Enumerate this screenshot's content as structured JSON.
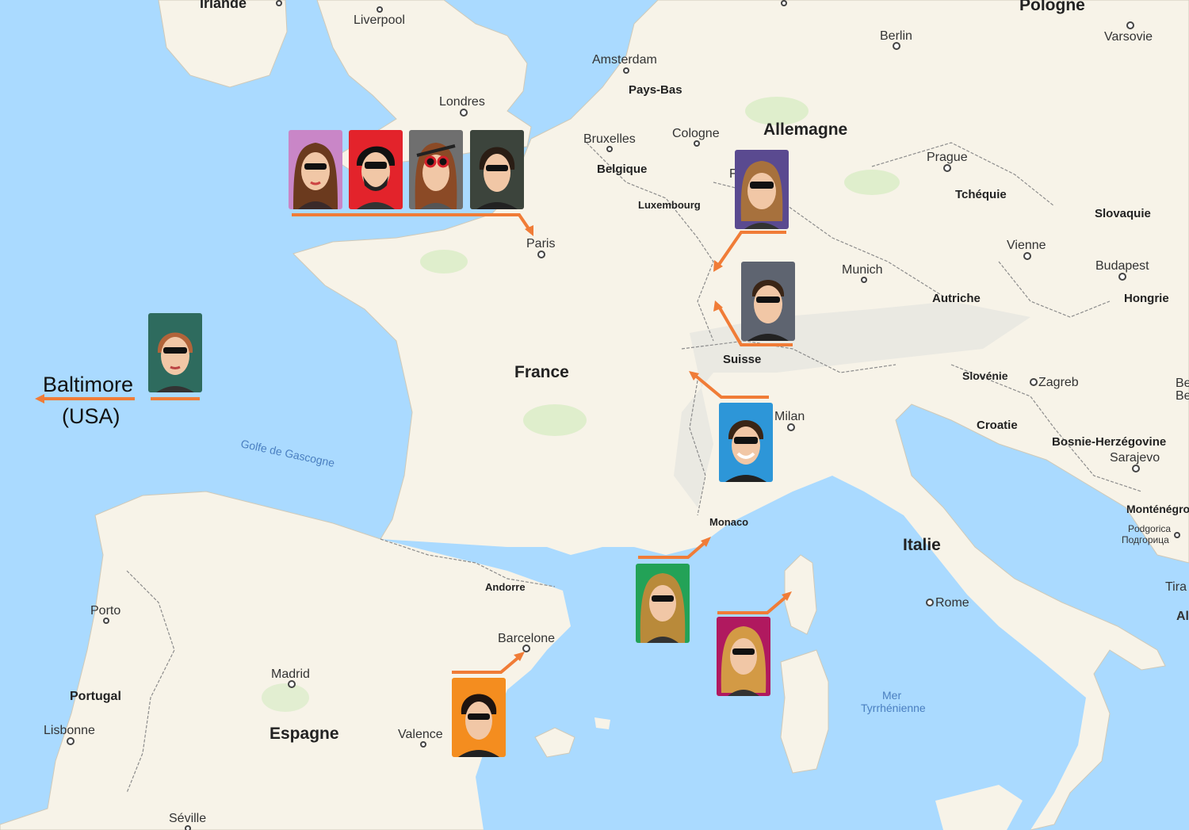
{
  "map": {
    "water": {
      "golfe": "Golfe de Gascogne",
      "mer1": "Mer",
      "mer2": "Tyrrhénienne"
    },
    "countries": {
      "irlande": "Irlande",
      "pologne": "Pologne",
      "allemagne": "Allemagne",
      "france": "France",
      "belgique": "Belgique",
      "pays_bas": "Pays-Bas",
      "tcheque": "Tchéquie",
      "slovaquie": "Slovaquie",
      "autriche": "Autriche",
      "hongrie": "Hongrie",
      "suisse": "Suisse",
      "slovenie": "Slovénie",
      "croatie": "Croatie",
      "bosnie": "Bosnie-Herzégovine",
      "montenegro": "Monténégro",
      "italie": "Italie",
      "espagne": "Espagne",
      "portugal": "Portugal",
      "andorre": "Andorre",
      "monaco": "Monaco",
      "luxembourg": "Luxembourg"
    },
    "cities": {
      "liverpool": "Liverpool",
      "londres": "Londres",
      "amsterdam": "Amsterdam",
      "berlin": "Berlin",
      "varsovie": "Varsovie",
      "bruxelles": "Bruxelles",
      "cologne": "Cologne",
      "prague": "Prague",
      "paris": "Paris",
      "vienne": "Vienne",
      "budapest": "Budapest",
      "munich": "Munich",
      "zagreb": "Zagreb",
      "milan": "Milan",
      "sarajevo": "Sarajevo",
      "podgorica1": "Podgorica",
      "podgorica2": "Подгорица",
      "rome": "Rome",
      "tira": "Tira",
      "al": "Al",
      "be1": "Be",
      "be2": "Be",
      "porto": "Porto",
      "madrid": "Madrid",
      "lisbonne": "Lisbonne",
      "barcelone": "Barcelone",
      "valence": "Valence",
      "seville": "Séville",
      "f": "F"
    }
  },
  "annotation": {
    "city": "Baltimore",
    "country": "(USA)"
  },
  "colors": {
    "arrow": "#f07c37",
    "water": "#aadaff",
    "land": "#f7f3e8",
    "forest": "#c9e6b1",
    "mountain": "#e2e2dc",
    "border": "#8c8c8c",
    "card_pink": "#c986c7",
    "card_red": "#e3232b",
    "card_grey": "#6f6f6f",
    "card_dark": "#3c443c",
    "card_purple": "#5a4a90",
    "card_slate": "#5e6470",
    "card_teal": "#2e6b5e",
    "card_blue": "#2d96d8",
    "card_green": "#23a257",
    "card_magenta": "#b0195f",
    "card_orange": "#f48d1f"
  },
  "cards": [
    {
      "name": "pink-masked-woman",
      "icon": "masked-woman-icon"
    },
    {
      "name": "red-bearded-man",
      "icon": "masked-bearded-man-icon"
    },
    {
      "name": "grey-woman-red-glasses",
      "icon": "woman-red-glasses-icon"
    },
    {
      "name": "dark-green-man",
      "icon": "masked-man-icon"
    },
    {
      "name": "purple-woman",
      "icon": "masked-woman-icon"
    },
    {
      "name": "slate-man",
      "icon": "masked-man-icon"
    },
    {
      "name": "teal-woman",
      "icon": "masked-woman-icon"
    },
    {
      "name": "blue-man",
      "icon": "masked-man-icon"
    },
    {
      "name": "green-blonde-woman",
      "icon": "masked-woman-icon"
    },
    {
      "name": "magenta-blonde-woman",
      "icon": "masked-woman-icon"
    },
    {
      "name": "orange-man",
      "icon": "masked-man-icon"
    }
  ]
}
